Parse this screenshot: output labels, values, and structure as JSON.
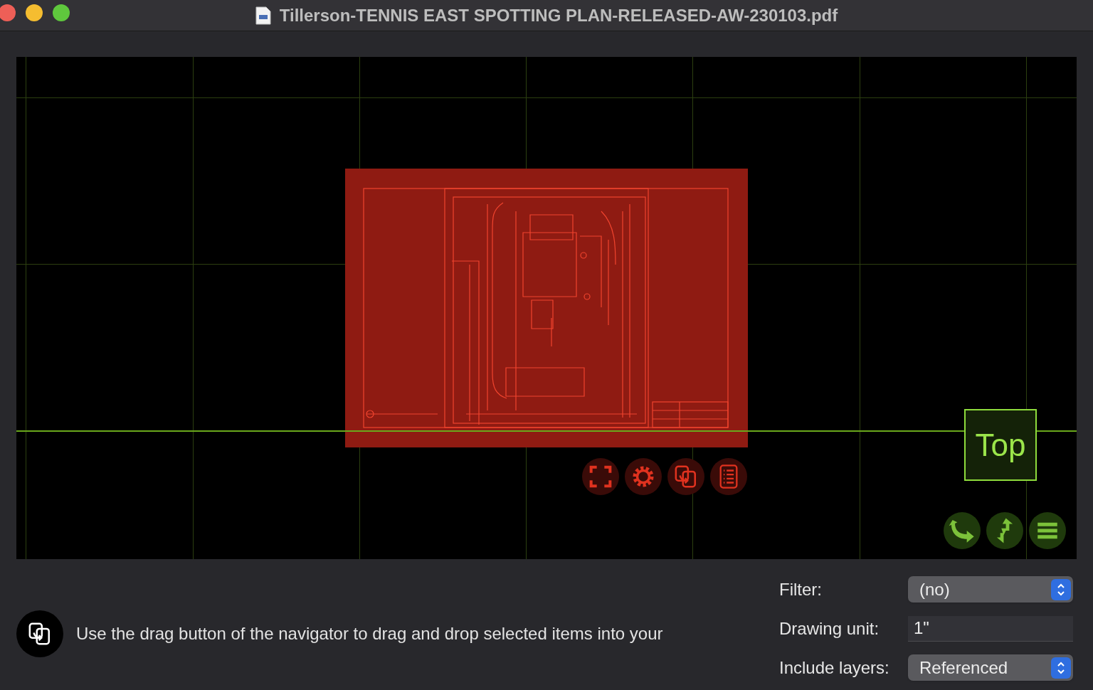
{
  "window": {
    "title": "Tillerson-TENNIS EAST SPOTTING PLAN-RELEASED-AW-230103.pdf"
  },
  "navigator": {
    "view_label": "Top"
  },
  "hint": "Use the drag button of the navigator to drag and drop selected items into your",
  "settings": [
    {
      "kind": "popup",
      "label": "Filter:",
      "value": "(no)"
    },
    {
      "kind": "text",
      "label": "Drawing unit:",
      "value": "1\""
    },
    {
      "kind": "popup",
      "label": "Include layers:",
      "value": "Referenced"
    }
  ]
}
